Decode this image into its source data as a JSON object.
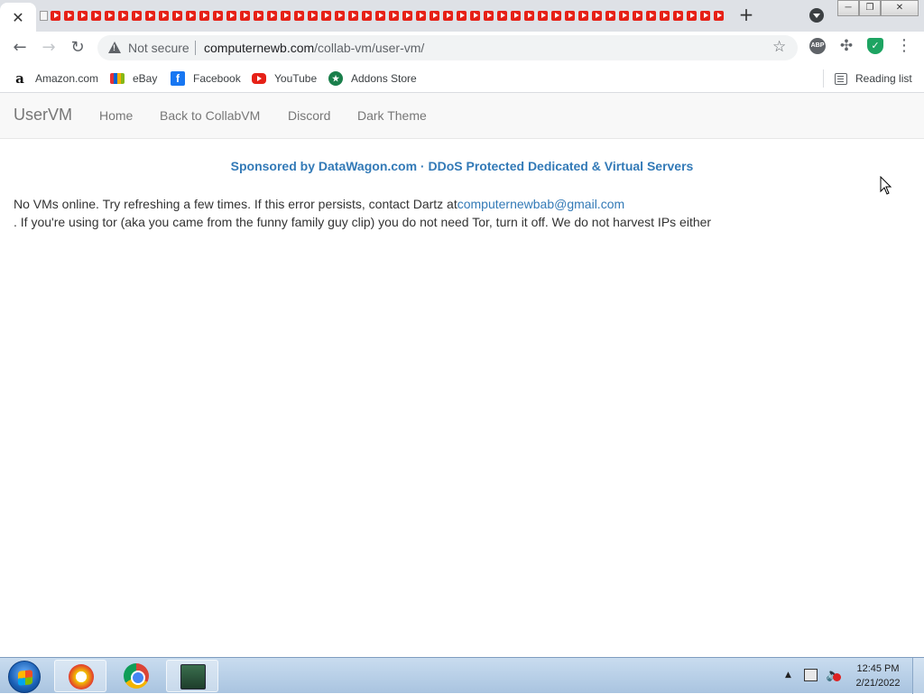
{
  "browser": {
    "active_tab_close": "✕",
    "new_tab_label": "+",
    "window_controls": {
      "minimize": "─",
      "restore": "❐",
      "close": "✕"
    },
    "nav": {
      "back": "←",
      "forward": "→",
      "reload": "↻"
    },
    "omnibox": {
      "security_text": "Not secure",
      "url_domain": "computernewb.com",
      "url_path": "/collab-vm/user-vm/"
    },
    "star": "☆",
    "menu": "⋮",
    "extensions": {
      "abp": "ABP",
      "puzzle": "✣",
      "shield": "✓"
    }
  },
  "bookmarks": [
    {
      "label": "Amazon.com",
      "icon": "amazon-icon",
      "glyph": "a"
    },
    {
      "label": "eBay",
      "icon": "ebay-icon",
      "glyph": ""
    },
    {
      "label": "Facebook",
      "icon": "facebook-icon",
      "glyph": "f"
    },
    {
      "label": "YouTube",
      "icon": "youtube-icon",
      "glyph": ""
    },
    {
      "label": "Addons Store",
      "icon": "addons-store-icon",
      "glyph": "★"
    }
  ],
  "reading_list": "Reading list",
  "page": {
    "brand": "UserVM",
    "nav": [
      "Home",
      "Back to CollabVM",
      "Discord",
      "Dark Theme"
    ],
    "sponsor": "Sponsored by DataWagon.com · DDoS Protected Dedicated & Virtual Servers",
    "message_part1": "No VMs online. Try refreshing a few times. If this error persists, contact Dartz at",
    "email": "computernewbab@gmail.com",
    "message_part2": ". If you're using tor (aka you came from the funny family guy clip) you do not need Tor, turn it off. We do not harvest IPs either"
  },
  "taskbar": {
    "tray_arrow": "▲",
    "time": "12:45 PM",
    "date": "2/21/2022"
  }
}
